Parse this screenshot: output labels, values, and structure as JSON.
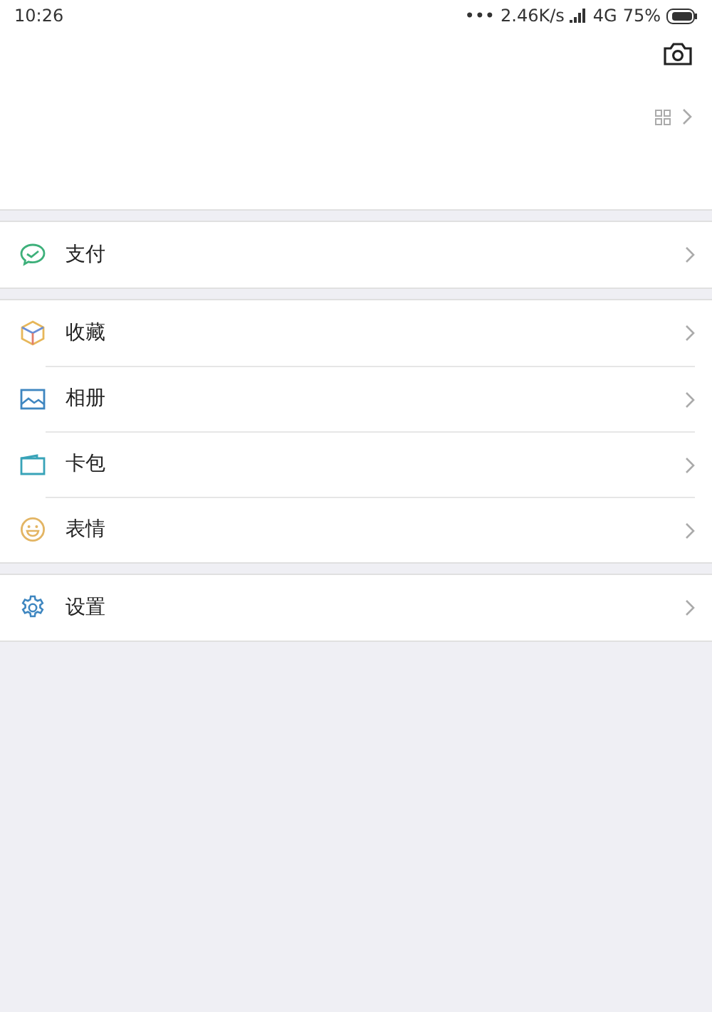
{
  "status_bar": {
    "time": "10:26",
    "dots": "•••",
    "network_speed": "2.46K/s",
    "network_type": "4G",
    "battery": "75%"
  },
  "groups": [
    {
      "items": [
        {
          "label": "支付",
          "kind": "pay"
        }
      ]
    },
    {
      "items": [
        {
          "label": "收藏",
          "kind": "favorites"
        },
        {
          "label": "相册",
          "kind": "album"
        },
        {
          "label": "卡包",
          "kind": "cards"
        },
        {
          "label": "表情",
          "kind": "stickers"
        }
      ]
    },
    {
      "items": [
        {
          "label": "设置",
          "kind": "settings"
        }
      ]
    }
  ]
}
